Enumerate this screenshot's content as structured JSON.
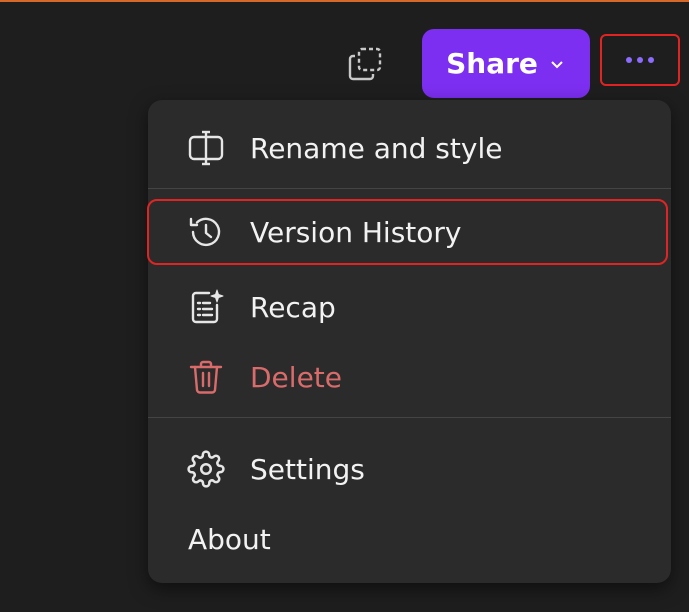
{
  "toolbar": {
    "share_label": "Share",
    "copy_icon": "copy-icon",
    "more_icon": "more-horizontal-icon"
  },
  "menu": {
    "items": [
      {
        "label": "Rename and style",
        "icon": "rename-icon"
      },
      {
        "label": "Version History",
        "icon": "history-icon"
      },
      {
        "label": "Recap",
        "icon": "recap-icon"
      },
      {
        "label": "Delete",
        "icon": "trash-icon"
      },
      {
        "label": "Settings",
        "icon": "gear-icon"
      },
      {
        "label": "About"
      }
    ]
  },
  "colors": {
    "background": "#1e1e1e",
    "menu": "#2b2b2b",
    "accent": "#7c2ff0",
    "danger": "#d96b6b",
    "highlight": "#e02424",
    "top_accent": "#d4692a"
  }
}
